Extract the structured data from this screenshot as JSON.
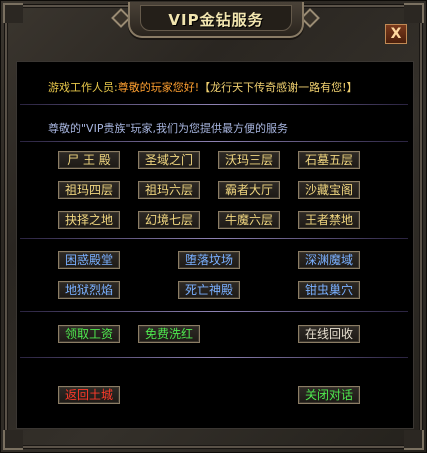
{
  "window": {
    "title": "VIP金钻服务",
    "close_label": "X"
  },
  "intro": {
    "speaker": "游戏工作人员:",
    "greeting": "尊敬的玩家您好!",
    "slogan": "【龙行天下传奇感谢一路有您!】"
  },
  "info": "尊敬的\"VIP贵族\"玩家,我们为您提供最方便的服务",
  "teleport_buttons": [
    {
      "label": "尸 王 殿"
    },
    {
      "label": "圣域之门"
    },
    {
      "label": "沃玛三层"
    },
    {
      "label": "石墓五层"
    },
    {
      "label": "祖玛四层"
    },
    {
      "label": "祖玛六层"
    },
    {
      "label": "霸者大厅"
    },
    {
      "label": "沙藏宝阁"
    },
    {
      "label": "抉择之地"
    },
    {
      "label": "幻境七层"
    },
    {
      "label": "牛魔六层"
    },
    {
      "label": "王者禁地"
    }
  ],
  "map_buttons": [
    {
      "label": "困惑殿堂"
    },
    {
      "label": "堕落坟场"
    },
    {
      "label": "深渊魔域"
    },
    {
      "label": "地狱烈焰"
    },
    {
      "label": "死亡神殿"
    },
    {
      "label": "钳虫巢穴"
    }
  ],
  "service_buttons": {
    "salary": "领取工资",
    "clear_red": "免费洗红",
    "online_recycle": "在线回收"
  },
  "footer_buttons": {
    "return_city": "返回土城",
    "close_dialog": "关闭对话"
  },
  "colors": {
    "teleport_text": "#f0d680",
    "map_text": "#7ab0ff",
    "service_text": "#4ee84e",
    "danger_text": "#ff3a2a",
    "border": "#8b7d65",
    "divider": "#8e82b3"
  }
}
